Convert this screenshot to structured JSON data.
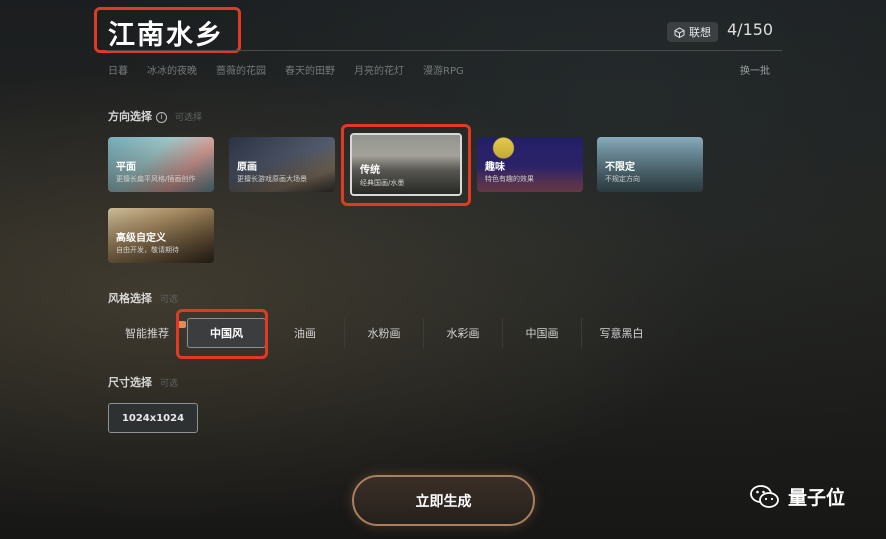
{
  "prompt": {
    "text": "江南水乡",
    "associate_label": "联想",
    "counter": "4/150"
  },
  "suggestions": {
    "items": [
      "日暮",
      "冰冰的夜晚",
      "蔷薇的花园",
      "春天的田野",
      "月亮的花灯",
      "漫游RPG"
    ],
    "refresh_label": "换一批"
  },
  "direction": {
    "label": "方向选择",
    "hint": "可选择",
    "cards": [
      {
        "name": "平面",
        "desc": "更擅长扁平风格/插画创作"
      },
      {
        "name": "原画",
        "desc": "更擅长游戏原画大场景"
      },
      {
        "name": "传统",
        "desc": "经典国画/水墨"
      },
      {
        "name": "趣味",
        "desc": "特色有趣的效果"
      },
      {
        "name": "不限定",
        "desc": "不规定方向"
      },
      {
        "name": "高级自定义",
        "desc": "自由开发，敬请期待"
      }
    ]
  },
  "style": {
    "label": "风格选择",
    "hint": "可选",
    "tabs": [
      "智能推荐",
      "中国风",
      "油画",
      "水粉画",
      "水彩画",
      "中国画",
      "写意黑白"
    ],
    "active": "中国风"
  },
  "size": {
    "label": "尺寸选择",
    "hint": "可选",
    "value": "1024x1024"
  },
  "generate_label": "立即生成",
  "watermark": "量子位",
  "colors": {
    "highlight": "#e23a22",
    "generate_border": "#a88060"
  }
}
